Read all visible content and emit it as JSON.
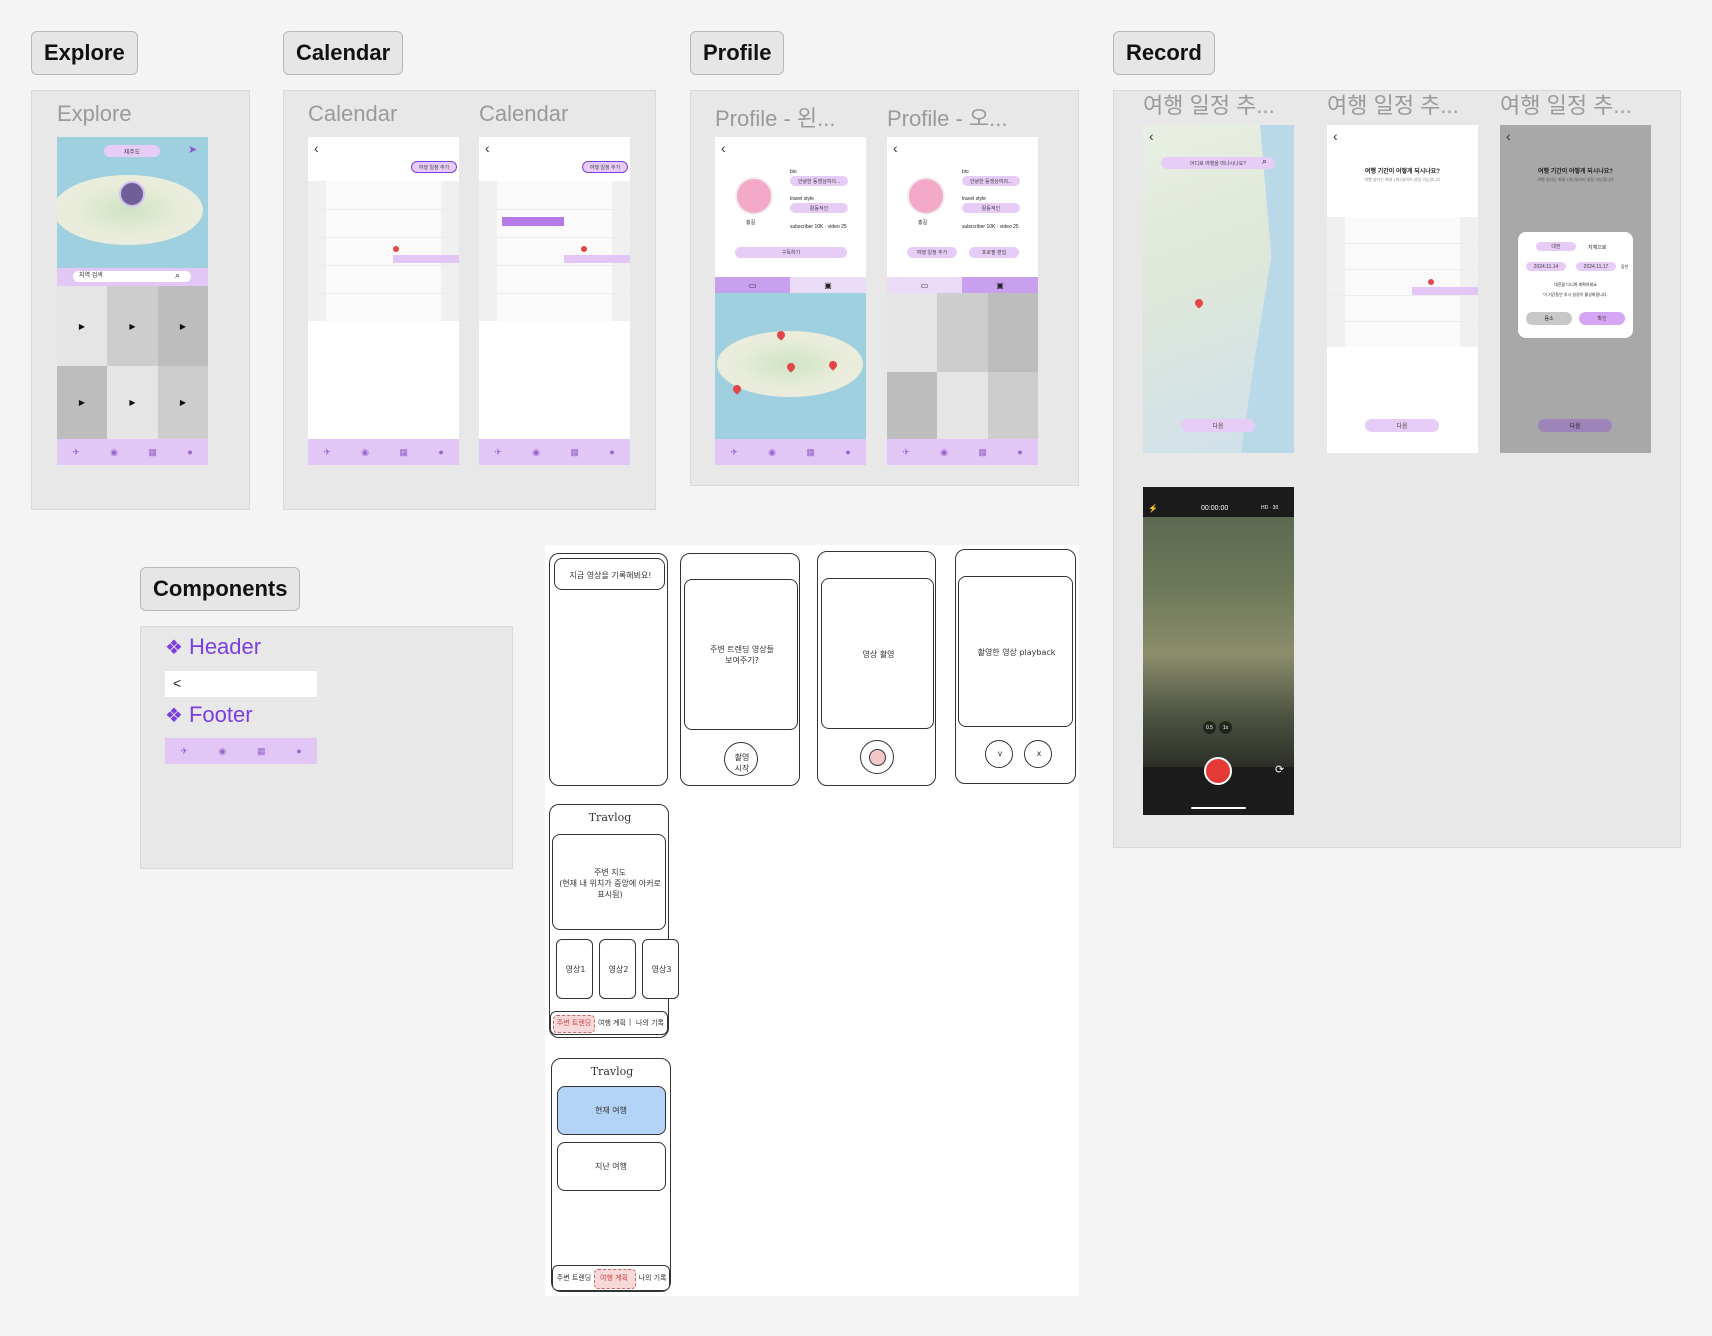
{
  "sections": {
    "explore": "Explore",
    "calendar": "Calendar",
    "profile": "Profile",
    "record": "Record",
    "components": "Components"
  },
  "explore": {
    "frame_title": "Explore",
    "region_chip": "제주도",
    "search_placeholder": "지역 검색",
    "play_glyph": "▶"
  },
  "calendar": {
    "frame1_title": "Calendar",
    "frame2_title": "Calendar",
    "add_trip_btn": "여행 일정 추가"
  },
  "profile": {
    "frame1_title": "Profile - 왼...",
    "frame2_title": "Profile - 오...",
    "bio_label": "bio",
    "bio_value": "안녕한 동쟁상여의...",
    "style_label": "travel style",
    "style_value": "활동적인",
    "name": "홍길",
    "stats": "subscriber 10K · video 25",
    "subscribe_btn": "구독하기",
    "add_trip_btn": "여행 일정 추가",
    "edit_profile_btn": "프로필 편집"
  },
  "record": {
    "frame1_title": "여행 일정 추...",
    "frame2_title": "여행 일정 추...",
    "frame3_title": "여행 일정 추...",
    "map_search": "어디로 여행을 떠나시나요?",
    "next_btn": "다음",
    "question": "여행 기간이 어떻게 되시나요?",
    "sub_question": "여행 일자는 최대 1박2일까지 설정 가능합니다",
    "dialog_city": "대전",
    "dialog_checkin": "지체으로",
    "date_from": "2024.11.14",
    "date_to": "2024.11.17",
    "date_suffix": "동안",
    "dialog_line1": "대전을 다니며 계획하세요",
    "dialog_line2": "이 기간동안 추시 일정이 활성화됩니다.",
    "cancel_btn": "음소",
    "confirm_btn": "확인",
    "camera_timer": "00:00:00",
    "camera_quality": "HD · 30",
    "zoom_a": "0.5",
    "zoom_b": "1x"
  },
  "components": {
    "header_label": "Header",
    "footer_label": "Footer",
    "back_glyph": "<"
  },
  "footer_icons": [
    "explore",
    "record",
    "calendar",
    "profile"
  ],
  "wireframes": {
    "w1_text": "지금 영상을 기록해봐요!",
    "w2_text": "주변 트렌딩 영상들\n보여주기?",
    "w2_button": "촬영\n시작",
    "w3_text": "영상 촬영",
    "w4_text": "촬영한 영상 playback",
    "w4_ok": "v",
    "w4_cancel": "x",
    "app_title": "Travlog",
    "map_text": "주변 지도\n(현재 내 위치가 중앙에 아커로 표시됨)",
    "video1": "영상1",
    "video2": "영상2",
    "video3": "영상3",
    "nav1": "주변 트렌딩",
    "nav2": "여행 계획",
    "nav3": "나의 기록",
    "nav_sep": "|",
    "current_trip": "현재 여행",
    "past_trip": "지난 여행"
  },
  "colors": {
    "accent_purple": "#e2c6f5",
    "component_title": "#7b3fe0",
    "map_water": "#9fd0df",
    "record_red": "#e53935",
    "wire_highlight_blue": "#b3d4f7",
    "wire_highlight_pink": "#f7d9d9"
  }
}
